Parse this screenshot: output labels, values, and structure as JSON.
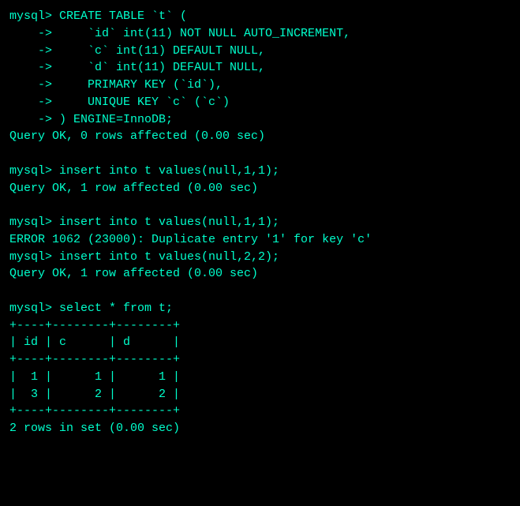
{
  "terminal": {
    "lines": [
      {
        "id": "l1",
        "text": "mysql> CREATE TABLE `t` ("
      },
      {
        "id": "l2",
        "text": "    ->     `id` int(11) NOT NULL AUTO_INCREMENT,"
      },
      {
        "id": "l3",
        "text": "    ->     `c` int(11) DEFAULT NULL,"
      },
      {
        "id": "l4",
        "text": "    ->     `d` int(11) DEFAULT NULL,"
      },
      {
        "id": "l5",
        "text": "    ->     PRIMARY KEY (`id`),"
      },
      {
        "id": "l6",
        "text": "    ->     UNIQUE KEY `c` (`c`)"
      },
      {
        "id": "l7",
        "text": "    -> ) ENGINE=InnoDB;"
      },
      {
        "id": "l8",
        "text": "Query OK, 0 rows affected (0.00 sec)"
      },
      {
        "id": "l9",
        "text": ""
      },
      {
        "id": "l10",
        "text": "mysql> insert into t values(null,1,1);"
      },
      {
        "id": "l11",
        "text": "Query OK, 1 row affected (0.00 sec)"
      },
      {
        "id": "l12",
        "text": ""
      },
      {
        "id": "l13",
        "text": "mysql> insert into t values(null,1,1);"
      },
      {
        "id": "l14",
        "text": "ERROR 1062 (23000): Duplicate entry '1' for key 'c'"
      },
      {
        "id": "l15",
        "text": "mysql> insert into t values(null,2,2);"
      },
      {
        "id": "l16",
        "text": "Query OK, 1 row affected (0.00 sec)"
      },
      {
        "id": "l17",
        "text": ""
      },
      {
        "id": "l18",
        "text": "mysql> select * from t;"
      },
      {
        "id": "l19",
        "text": "+----+--------+--------+"
      },
      {
        "id": "l20",
        "text": "| id | c      | d      |"
      },
      {
        "id": "l21",
        "text": "+----+--------+--------+"
      },
      {
        "id": "l22",
        "text": "|  1 |      1 |      1 |"
      },
      {
        "id": "l23",
        "text": "|  3 |      2 |      2 |"
      },
      {
        "id": "l24",
        "text": "+----+--------+--------+"
      },
      {
        "id": "l25",
        "text": "2 rows in set (0.00 sec)"
      }
    ]
  }
}
